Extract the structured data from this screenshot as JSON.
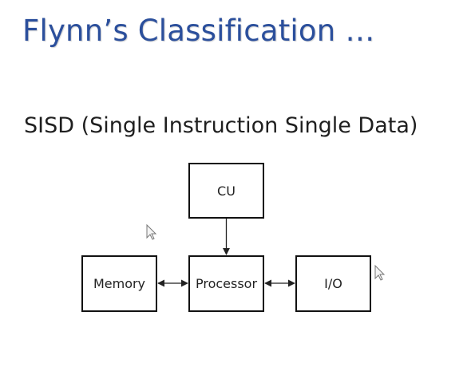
{
  "slide": {
    "title": "Flynn’s Classification …",
    "subtitle": "SISD (Single Instruction Single Data)"
  },
  "diagram": {
    "nodes": {
      "cu": "CU",
      "memory": "Memory",
      "processor": "Processor",
      "io": "I/O"
    }
  },
  "colors": {
    "title": "#2b4f9c",
    "text": "#1f1f1f",
    "stroke": "#111111"
  },
  "icons": [
    "mouse-pointer-icon"
  ]
}
